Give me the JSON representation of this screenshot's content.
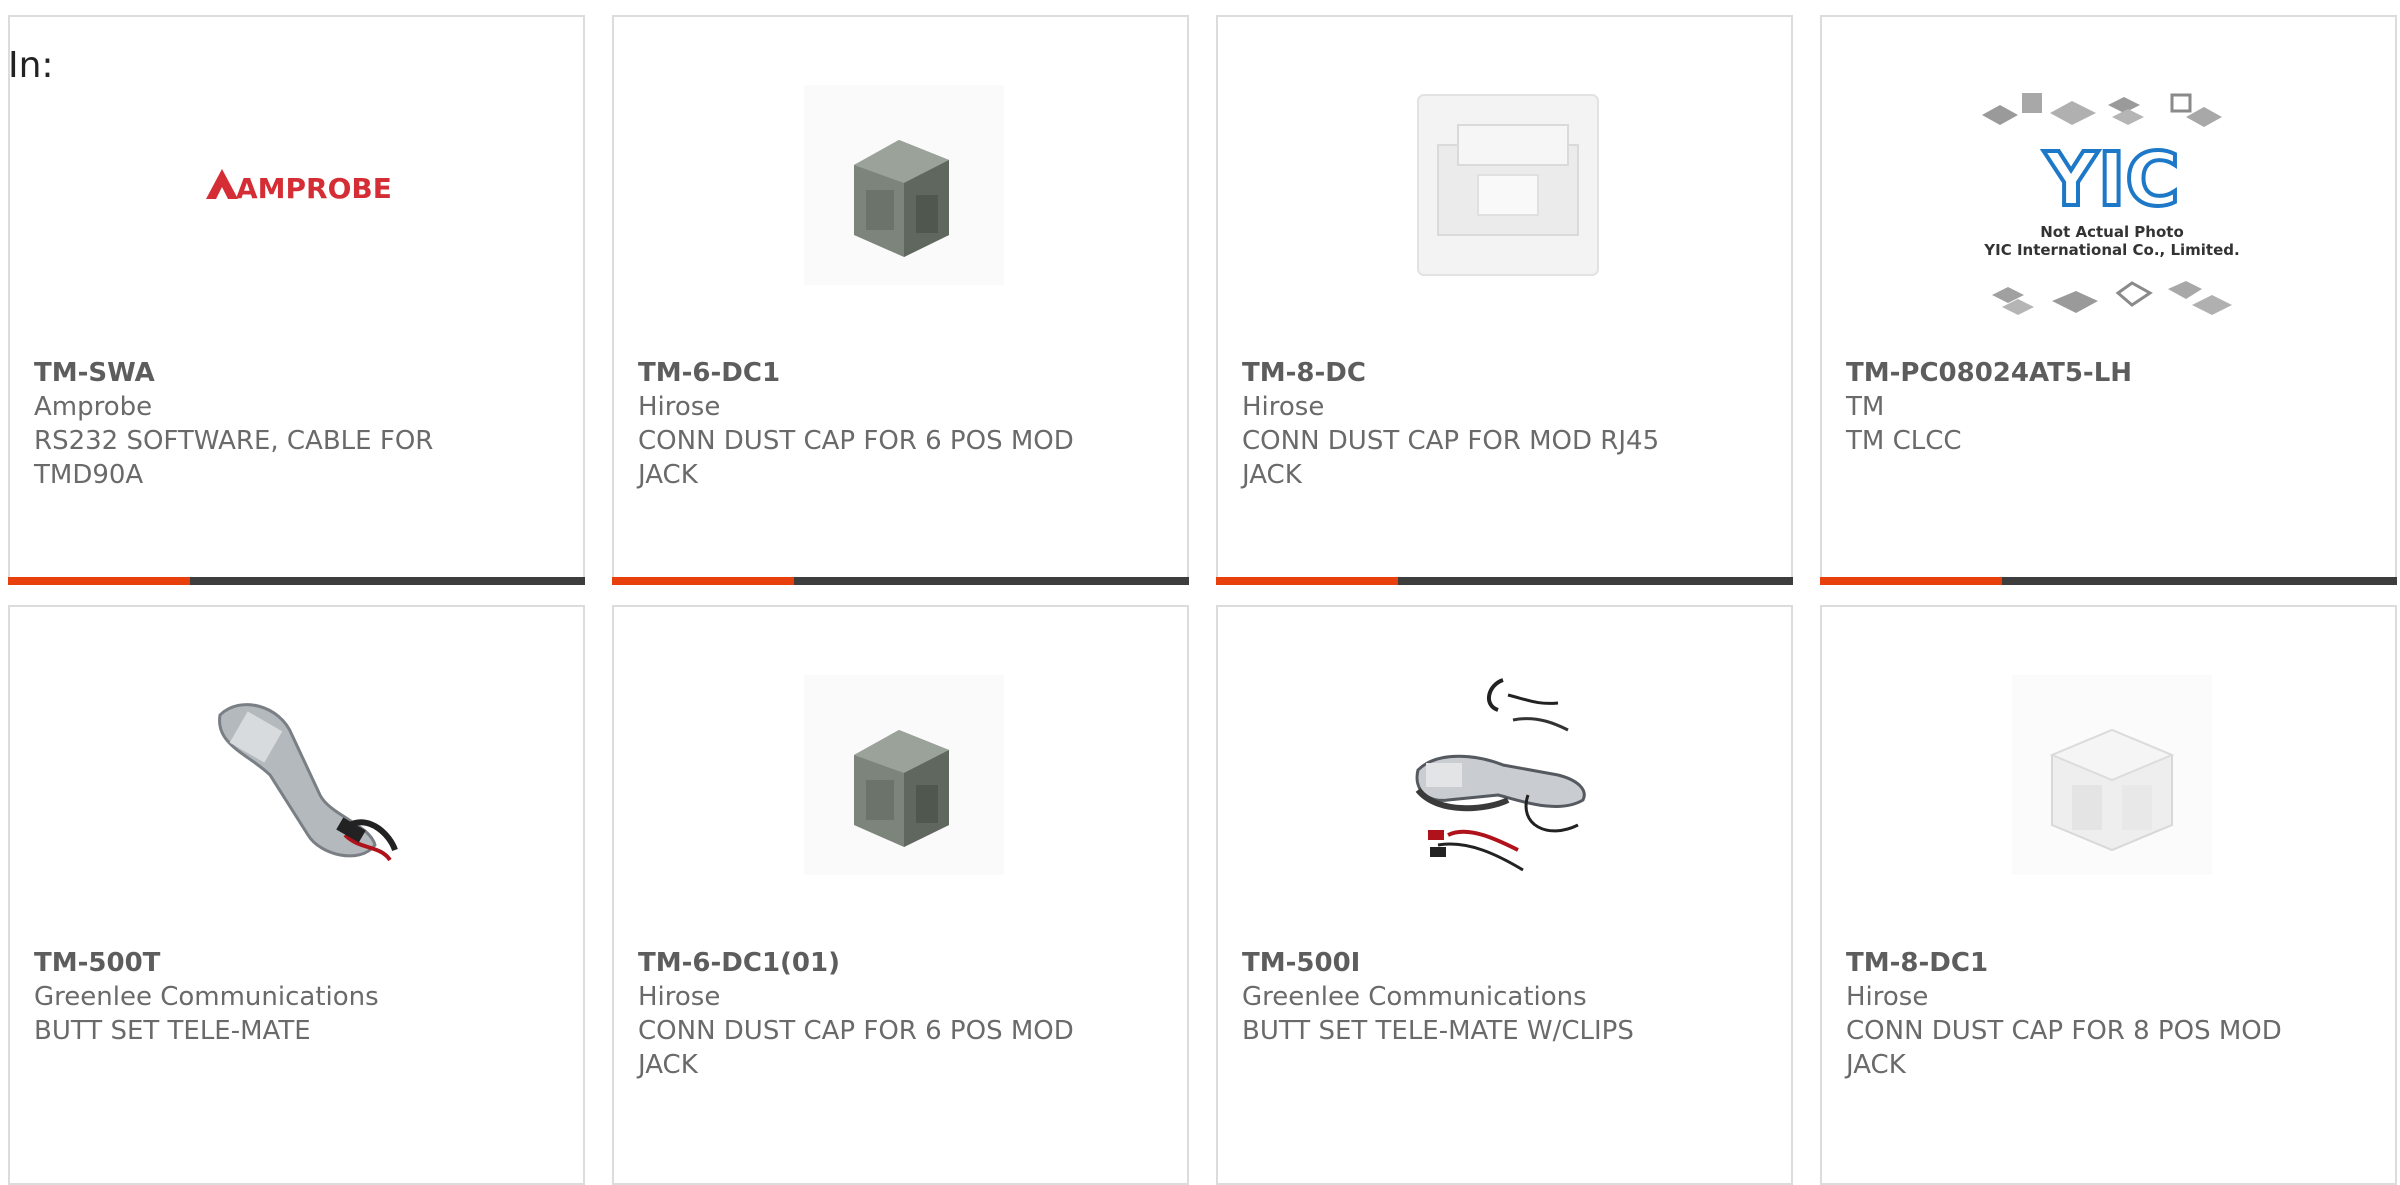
{
  "filter_label": "In:",
  "colors": {
    "accent": "#e8400c",
    "bar": "#3d3d3d",
    "border": "#dcdcdc",
    "text": "#6a6a6a"
  },
  "products": [
    {
      "part": "TM-SWA",
      "manufacturer": "Amprobe",
      "description": "RS232 SOFTWARE, CABLE FOR TMD90A",
      "image": "amprobe-logo",
      "logo_text": "AMPROBE"
    },
    {
      "part": "TM-6-DC1",
      "manufacturer": "Hirose",
      "description": "CONN DUST CAP FOR 6 POS MOD JACK",
      "image": "gray-dust-cap"
    },
    {
      "part": "TM-8-DC",
      "manufacturer": "Hirose",
      "description": "CONN DUST CAP FOR MOD RJ45 JACK",
      "image": "clear-dust-cap"
    },
    {
      "part": "TM-PC08024AT5-LH",
      "manufacturer": "TM",
      "description": "TM CLCC",
      "image": "yic-placeholder",
      "logo_text": "YIC",
      "photo_caption_1": "Not Actual Photo",
      "photo_caption_2": "YIC International Co., Limited."
    },
    {
      "part": "TM-500T",
      "manufacturer": "Greenlee Communications",
      "description": "BUTT SET TELE-MATE",
      "image": "butt-set"
    },
    {
      "part": "TM-6-DC1(01)",
      "manufacturer": "Hirose",
      "description": "CONN DUST CAP FOR 6 POS MOD JACK",
      "image": "gray-dust-cap"
    },
    {
      "part": "TM-500I",
      "manufacturer": "Greenlee Communications",
      "description": "BUTT SET TELE-MATE W/CLIPS",
      "image": "butt-set-clips"
    },
    {
      "part": "TM-8-DC1",
      "manufacturer": "Hirose",
      "description": "CONN DUST CAP FOR 8 POS MOD JACK",
      "image": "clear-dust-cap"
    }
  ]
}
